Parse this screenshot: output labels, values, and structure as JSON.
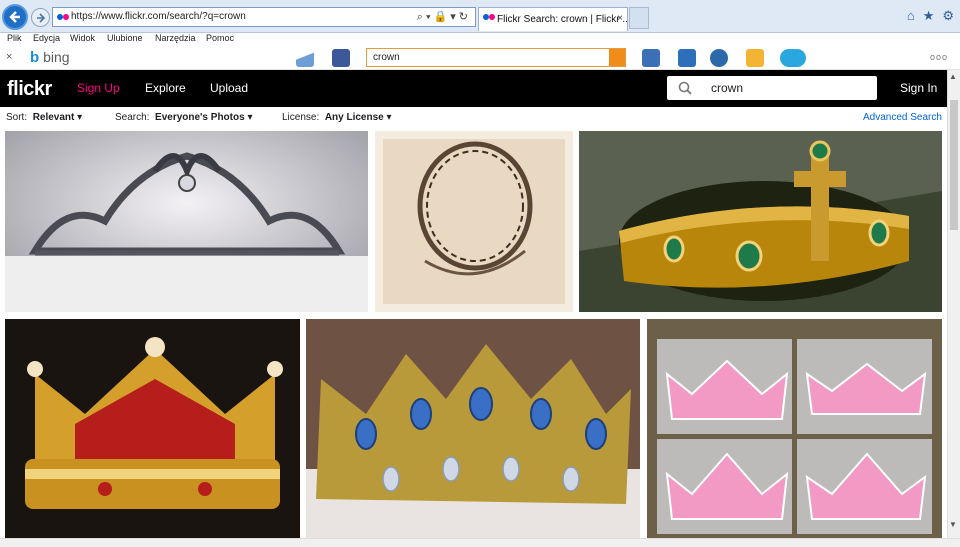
{
  "browser": {
    "url": "https://www.flickr.com/search/?q=crown",
    "tab_title": "Flickr Search: crown | Flickr ...",
    "tab_close": "×"
  },
  "menu": [
    "Plik",
    "Edycja",
    "Widok",
    "Ulubione",
    "Narzędzia",
    "Pomoc"
  ],
  "bing": {
    "close": "×",
    "logo_text": "bing",
    "search_value": "crown",
    "more": "ooo"
  },
  "flickr": {
    "logo": "flickr",
    "nav": {
      "signup": "Sign Up",
      "explore": "Explore",
      "upload": "Upload"
    },
    "search_value": "crown",
    "signin": "Sign In",
    "filters": {
      "sort_label": "Sort:",
      "sort_value": "Relevant",
      "search_label": "Search:",
      "search_value": "Everyone's Photos",
      "license_label": "License:",
      "license_value": "Any License",
      "advanced": "Advanced Search"
    }
  },
  "photos": [
    {
      "name": "photo-tiara"
    },
    {
      "name": "photo-crown-of-thorns"
    },
    {
      "name": "photo-gold-crown-jewels"
    },
    {
      "name": "photo-royal-crown-red"
    },
    {
      "name": "photo-jeweled-crown-blue"
    },
    {
      "name": "photo-pink-crown-cookies"
    }
  ],
  "colors": {
    "flickr_pink": "#ff0084",
    "flickr_blue": "#0063dc",
    "ie_blue": "#1f6fc5",
    "bing_orange": "#f08c1a"
  }
}
